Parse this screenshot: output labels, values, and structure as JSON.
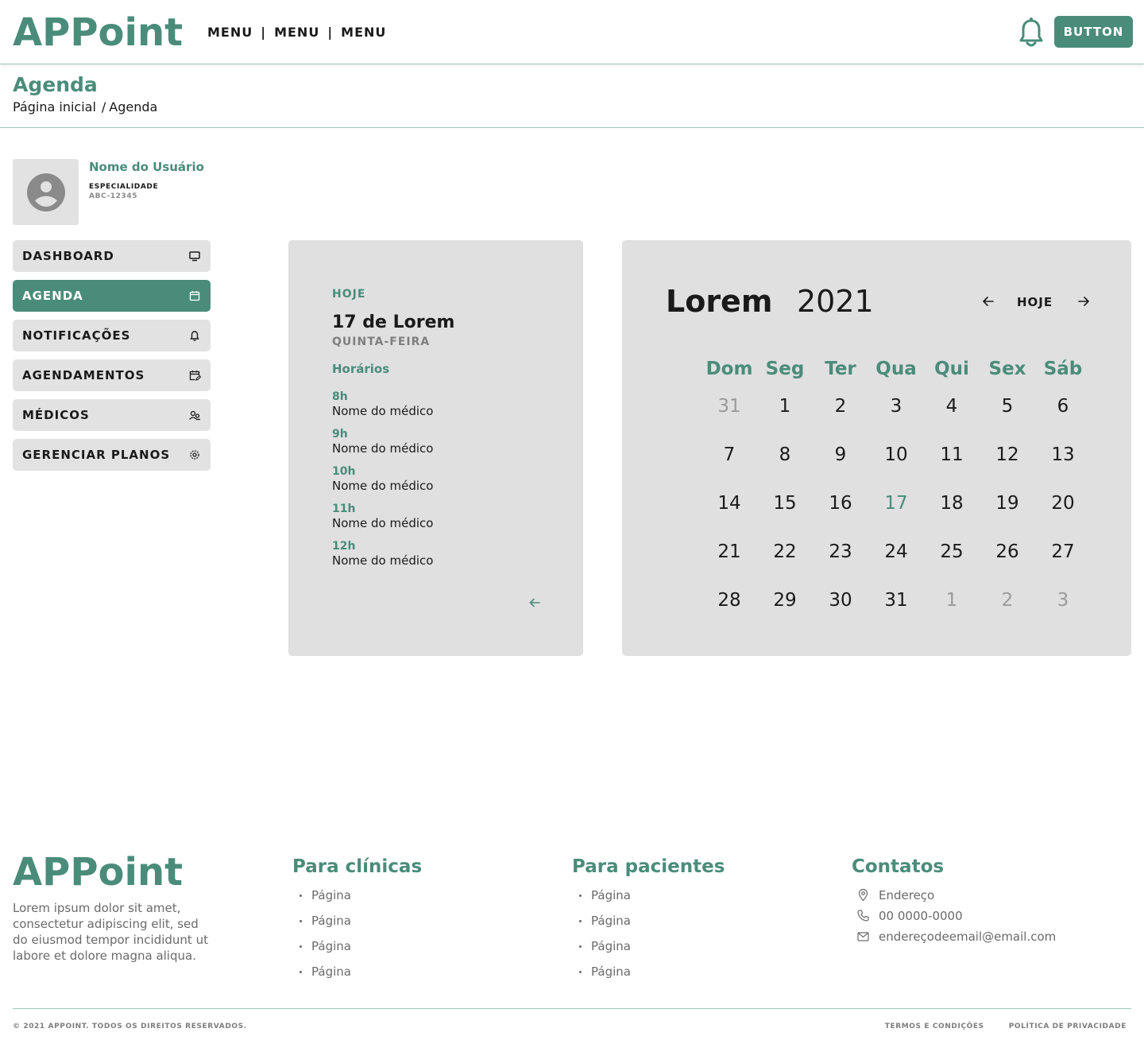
{
  "header": {
    "logo": "APPoint",
    "menu": [
      "MENU",
      "MENU",
      "MENU"
    ],
    "separator": "|",
    "button_label": "BUTTON"
  },
  "page": {
    "title": "Agenda",
    "breadcrumb": [
      "Página inicial",
      "Agenda"
    ],
    "breadcrumb_sep": "/"
  },
  "user": {
    "name": "Nome do Usuário",
    "specialty": "ESPECIALIDADE",
    "code": "ABC-12345"
  },
  "sidebar": {
    "items": [
      {
        "label": "DASHBOARD",
        "icon": "monitor-icon",
        "active": false
      },
      {
        "label": "AGENDA",
        "icon": "calendar-icon",
        "active": true
      },
      {
        "label": "NOTIFICAÇÕES",
        "icon": "bell-icon",
        "active": false
      },
      {
        "label": "AGENDAMENTOS",
        "icon": "calendar-edit-icon",
        "active": false
      },
      {
        "label": "MÉDICOS",
        "icon": "users-icon",
        "active": false
      },
      {
        "label": "GERENCIAR PLANOS",
        "icon": "gear-icon",
        "active": false
      }
    ]
  },
  "schedule": {
    "today_label": "HOJE",
    "date": "17 de Lorem",
    "weekday": "QUINTA-FEIRA",
    "section_label": "Horários",
    "slots": [
      {
        "time": "8h",
        "doctor": "Nome do médico"
      },
      {
        "time": "9h",
        "doctor": "Nome do médico"
      },
      {
        "time": "10h",
        "doctor": "Nome do médico"
      },
      {
        "time": "11h",
        "doctor": "Nome do médico"
      },
      {
        "time": "12h",
        "doctor": "Nome do médico"
      }
    ]
  },
  "calendar": {
    "month": "Lorem",
    "year": "2021",
    "today_button": "HOJE",
    "weekdays": [
      "Dom",
      "Seg",
      "Ter",
      "Qua",
      "Qui",
      "Sex",
      "Sáb"
    ],
    "weeks": [
      [
        {
          "d": "31",
          "muted": true
        },
        {
          "d": "1"
        },
        {
          "d": "2"
        },
        {
          "d": "3"
        },
        {
          "d": "4"
        },
        {
          "d": "5"
        },
        {
          "d": "6"
        }
      ],
      [
        {
          "d": "7"
        },
        {
          "d": "8"
        },
        {
          "d": "9"
        },
        {
          "d": "10"
        },
        {
          "d": "11"
        },
        {
          "d": "12"
        },
        {
          "d": "13"
        }
      ],
      [
        {
          "d": "14"
        },
        {
          "d": "15"
        },
        {
          "d": "16"
        },
        {
          "d": "17",
          "today": true
        },
        {
          "d": "18"
        },
        {
          "d": "19"
        },
        {
          "d": "20"
        }
      ],
      [
        {
          "d": "21"
        },
        {
          "d": "22"
        },
        {
          "d": "23"
        },
        {
          "d": "24"
        },
        {
          "d": "25"
        },
        {
          "d": "26"
        },
        {
          "d": "27"
        }
      ],
      [
        {
          "d": "28"
        },
        {
          "d": "29"
        },
        {
          "d": "30"
        },
        {
          "d": "31"
        },
        {
          "d": "1",
          "muted": true
        },
        {
          "d": "2",
          "muted": true
        },
        {
          "d": "3",
          "muted": true
        }
      ]
    ]
  },
  "footer": {
    "logo": "APPoint",
    "text": "Lorem ipsum dolor sit amet, consectetur adipiscing elit, sed do eiusmod tempor incididunt ut labore et dolore magna aliqua.",
    "clinics": {
      "title": "Para clínicas",
      "links": [
        "Página",
        "Página",
        "Página",
        "Página"
      ]
    },
    "patients": {
      "title": "Para pacientes",
      "links": [
        "Página",
        "Página",
        "Página",
        "Página"
      ]
    },
    "contacts": {
      "title": "Contatos",
      "address": "Endereço",
      "phone": "00 0000-0000",
      "email": "endereçodeemail@email.com"
    },
    "copyright": "© 2021 APPOINT. TODOS OS DIREITOS RESERVADOS.",
    "terms": "TERMOS E CONDIÇÕES",
    "privacy": "POLÍTICA DE PRIVACIDADE"
  },
  "colors": {
    "accent": "#4a8c7a",
    "panel": "#e0e0e0",
    "muted": "#9a9a9a"
  }
}
